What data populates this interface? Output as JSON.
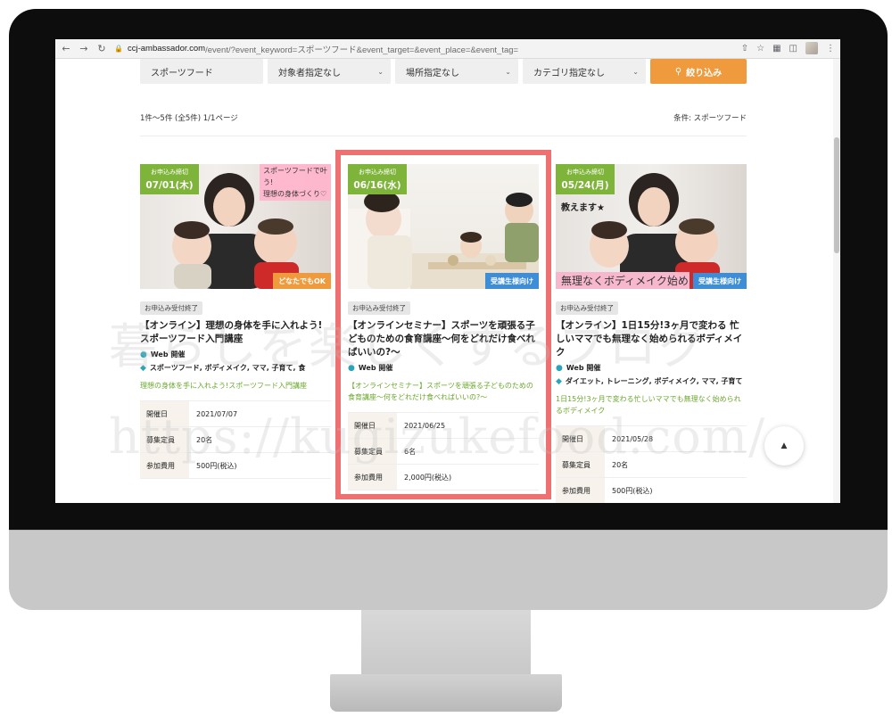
{
  "browser": {
    "url_host": "ccj-ambassador.com",
    "url_path": "/event/?event_keyword=スポーツフード&event_target=&event_place=&event_tag=",
    "back_icon": "arrow-left-icon",
    "forward_icon": "arrow-right-icon",
    "reload_icon": "reload-icon"
  },
  "filters": {
    "keyword": "スポーツフード",
    "target": "対象者指定なし",
    "place": "場所指定なし",
    "category": "カテゴリ指定なし",
    "button": "絞り込み"
  },
  "results": {
    "count": "1件〜5件 (全5件) 1/1ページ",
    "condition": "条件: スポーツフード"
  },
  "cards": [
    {
      "deadline_label": "お申込み締切",
      "deadline_date": "07/01(木)",
      "image_overlay": "スポーツフードで叶う!\n理想の身体づくり♡",
      "badge": "どなたでもOK",
      "status": "お申込み受付終了",
      "title": "【オンライン】理想の身体を手に入れよう!スポーツフード入門講座",
      "place": "Web 開催",
      "tags": "スポーツフード, ボディメイク, ママ, 子育て, 食",
      "desc": "理想の身体を手に入れよう!スポーツフード入門講座",
      "date_k": "開催日",
      "date_v": "2021/07/07",
      "cap_k": "募集定員",
      "cap_v": "20名",
      "fee_k": "参加費用",
      "fee_v": "500円(税込)"
    },
    {
      "deadline_label": "お申込み締切",
      "deadline_date": "06/16(水)",
      "badge": "受講生様向け",
      "status": "お申込み受付終了",
      "title": "【オンラインセミナー】スポーツを頑張る子どものための食育講座〜何をどれだけ食べればいいの?〜",
      "place": "Web 開催",
      "desc": "【オンラインセミナー】スポーツを頑張る子どものための食育講座〜何をどれだけ食べればいいの?〜",
      "date_k": "開催日",
      "date_v": "2021/06/25",
      "cap_k": "募集定員",
      "cap_v": "6名",
      "fee_k": "参加費用",
      "fee_v": "2,000円(税込)"
    },
    {
      "deadline_label": "お申込み締切",
      "deadline_date": "05/24(月)",
      "image_overlay": "教えます★",
      "image_overlay2": "無理なくボディメイク始め",
      "badge": "受講生様向け",
      "status": "お申込み受付終了",
      "title": "【オンライン】1日15分!3ヶ月で変わる 忙しいママでも無理なく始められるボディメイク",
      "place": "Web 開催",
      "tags": "ダイエット, トレーニング, ボディメイク, ママ, 子育て",
      "desc": "1日15分!3ヶ月で変わる忙しいママでも無理なく始められるボディメイク",
      "date_k": "開催日",
      "date_v": "2021/05/28",
      "cap_k": "募集定員",
      "cap_v": "20名",
      "fee_k": "参加費用",
      "fee_v": "500円(税込)"
    }
  ],
  "watermark": {
    "line1": "暮らしを楽しくするブログ",
    "line2": "https://kugizukefood.com/"
  },
  "colors": {
    "accent": "#f09a3e",
    "green": "#7fb43b",
    "highlight": "#ef7070",
    "blue_badge": "#3d8ed6"
  }
}
